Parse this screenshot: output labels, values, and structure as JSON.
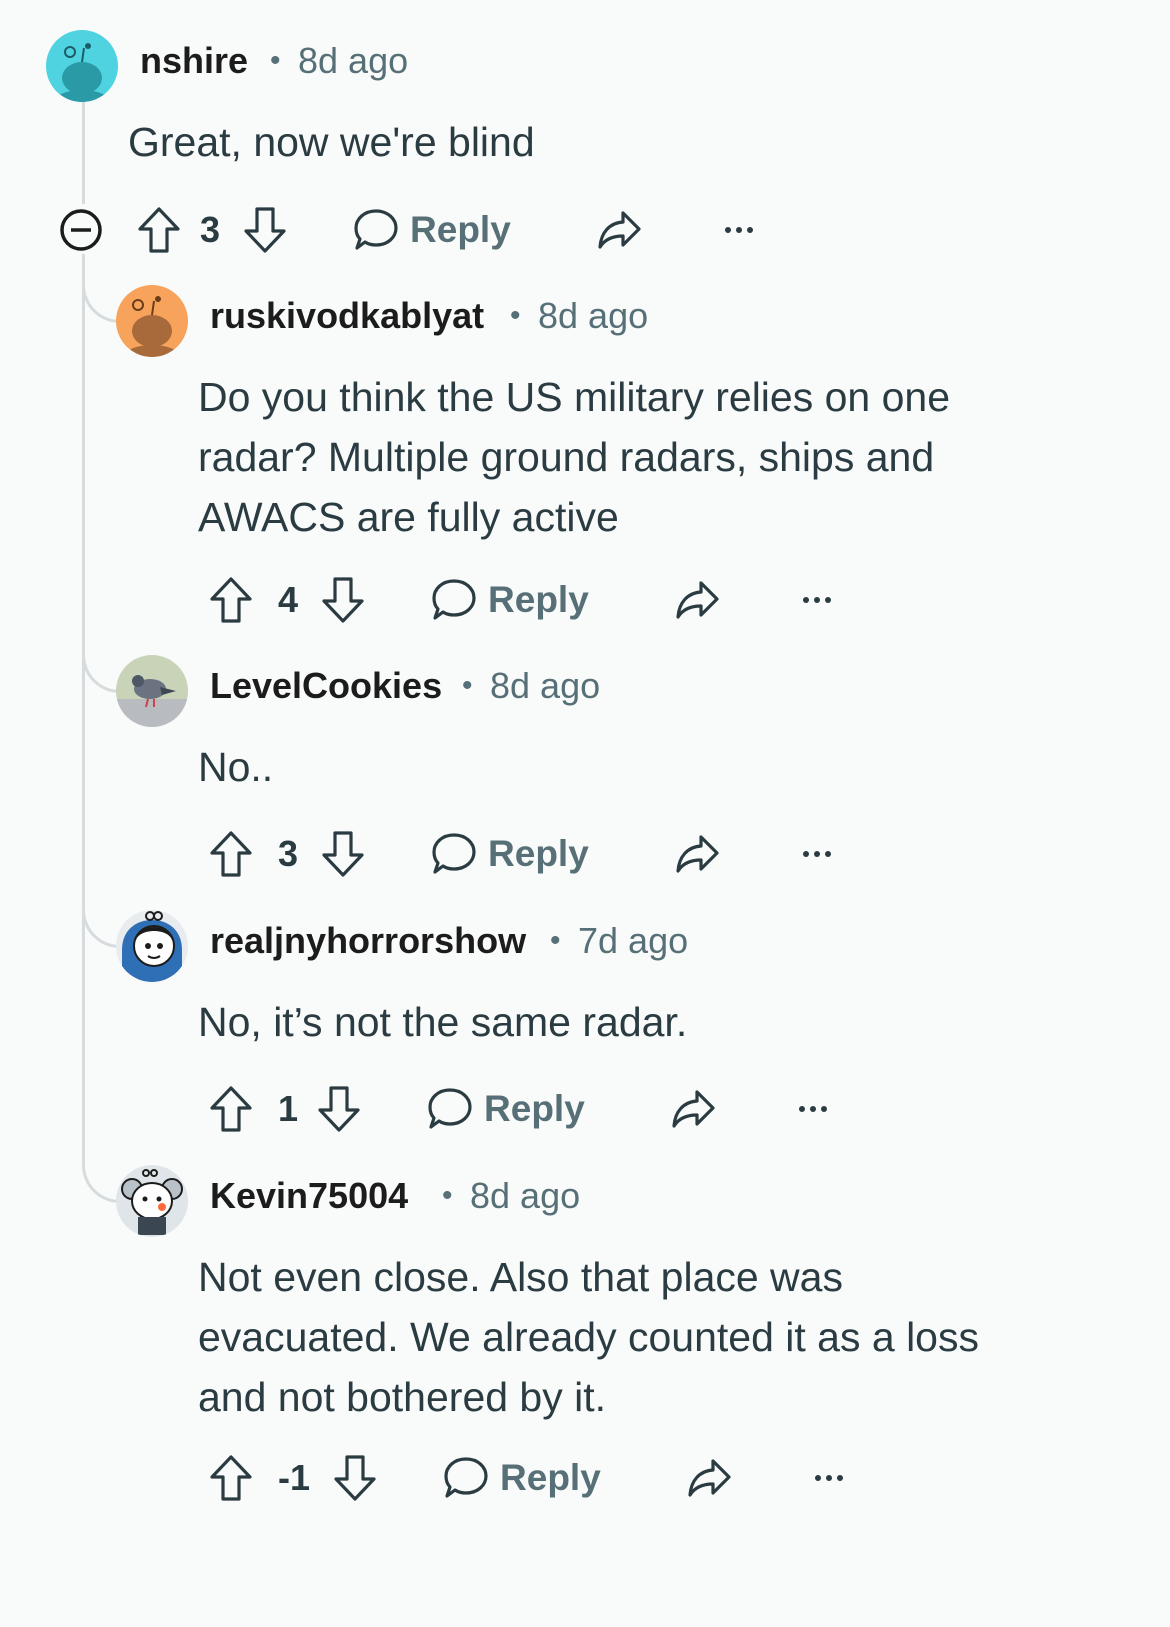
{
  "comments": [
    {
      "username": "nshire",
      "separator": "•",
      "time": "8d ago",
      "body": "Great, now we're blind",
      "score": "3",
      "reply_label": "Reply"
    },
    {
      "username": "ruskivodkablyat",
      "separator": "•",
      "time": "8d ago",
      "body": "Do you think the US military relies on one radar? Multiple ground radars, ships and AWACS are fully active",
      "score": "4",
      "reply_label": "Reply"
    },
    {
      "username": "LevelCookies",
      "separator": "•",
      "time": "8d ago",
      "body": "No..",
      "score": "3",
      "reply_label": "Reply"
    },
    {
      "username": "realjnyhorrorshow",
      "separator": "•",
      "time": "7d ago",
      "body": "No, it’s not the same radar.",
      "score": "1",
      "reply_label": "Reply"
    },
    {
      "username": "Kevin75004",
      "separator": "•",
      "time": "8d ago",
      "body": "Not even close. Also that place was evacuated. We already counted it as a loss and not bothered by it.",
      "score": "-1",
      "reply_label": "Reply"
    }
  ],
  "colors": {
    "background": "#f9fafa",
    "text": "#1c1c1c",
    "muted": "#576f76",
    "thread_line": "#d6dcde",
    "avatar_teal": "#4fd3e0",
    "avatar_orange": "#f7a35c"
  },
  "icons": [
    "collapse-icon",
    "upvote-icon",
    "downvote-icon",
    "reply-icon",
    "share-icon",
    "more-icon"
  ]
}
